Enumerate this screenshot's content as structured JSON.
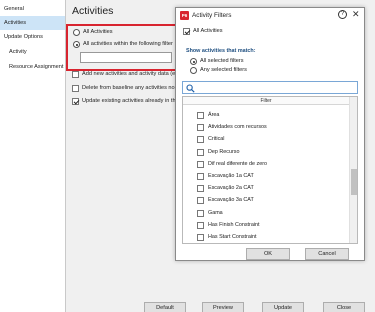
{
  "sidebar": {
    "items": [
      {
        "label": "General"
      },
      {
        "label": "Activities"
      },
      {
        "label": "Update Options"
      },
      {
        "label": "Activity"
      },
      {
        "label": "Resource Assignment"
      }
    ]
  },
  "main": {
    "title": "Activities",
    "radio_all": "All Activities",
    "radio_filter": "All activities within the following filter",
    "opt_add_new": "Add new activities and activity data (exce",
    "opt_delete": "Delete from baseline any activities no lon",
    "opt_update": "Update existing activities already in the b",
    "buttons": {
      "default": "Default",
      "preview": "Preview",
      "update": "Update",
      "close": "Close"
    }
  },
  "dialog": {
    "app_badge": "P6",
    "title": "Activity Filters",
    "help": "?",
    "close": "✕",
    "all_activities": "All Activities",
    "section": "Show activities that match:",
    "match_all": "All selected filters",
    "match_any": "Any selected filters",
    "search_icon": "magnifier-icon",
    "list_header": "Filter",
    "filters": [
      "Área",
      "Atividades com recursos",
      "Critical",
      "Dep Recurso",
      "Dif real diferente de zero",
      "Escavação 1a CAT",
      "Escavação 2a CAT",
      "Escavação 3a CAT",
      "Gama",
      "Has Finish Constraint",
      "Has Start Constraint"
    ],
    "ok": "OK",
    "cancel": "Cancel"
  },
  "colors": {
    "highlight_red": "#d8242f",
    "selected_nav": "#cde4f7",
    "section_blue": "#1f4f80"
  }
}
